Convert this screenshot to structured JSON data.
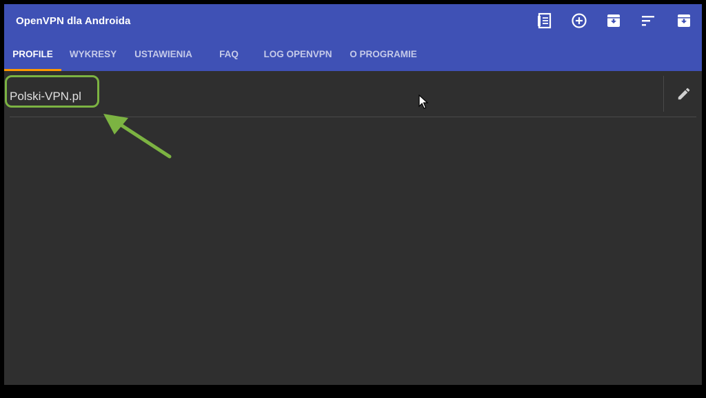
{
  "app": {
    "title": "OpenVPN dla Androida",
    "accent_color": "#3f51b5",
    "indicator_color": "#ff9800",
    "highlight_color": "#7cb342"
  },
  "toolbar": {
    "actions": [
      {
        "name": "import-file-icon"
      },
      {
        "name": "add-circle-icon"
      },
      {
        "name": "archive-download-icon"
      },
      {
        "name": "sort-icon"
      },
      {
        "name": "archive-download-icon"
      }
    ]
  },
  "tabs": [
    {
      "label": "PROFILE",
      "active": true
    },
    {
      "label": "WYKRESY",
      "active": false
    },
    {
      "label": "USTAWIENIA",
      "active": false
    },
    {
      "label": "FAQ",
      "active": false
    },
    {
      "label": "LOG OPENVPN",
      "active": false
    },
    {
      "label": "O PROGRAMIE",
      "active": false
    }
  ],
  "profiles": [
    {
      "name": "Polski-VPN.pl",
      "edit_icon": "pencil-icon"
    }
  ]
}
